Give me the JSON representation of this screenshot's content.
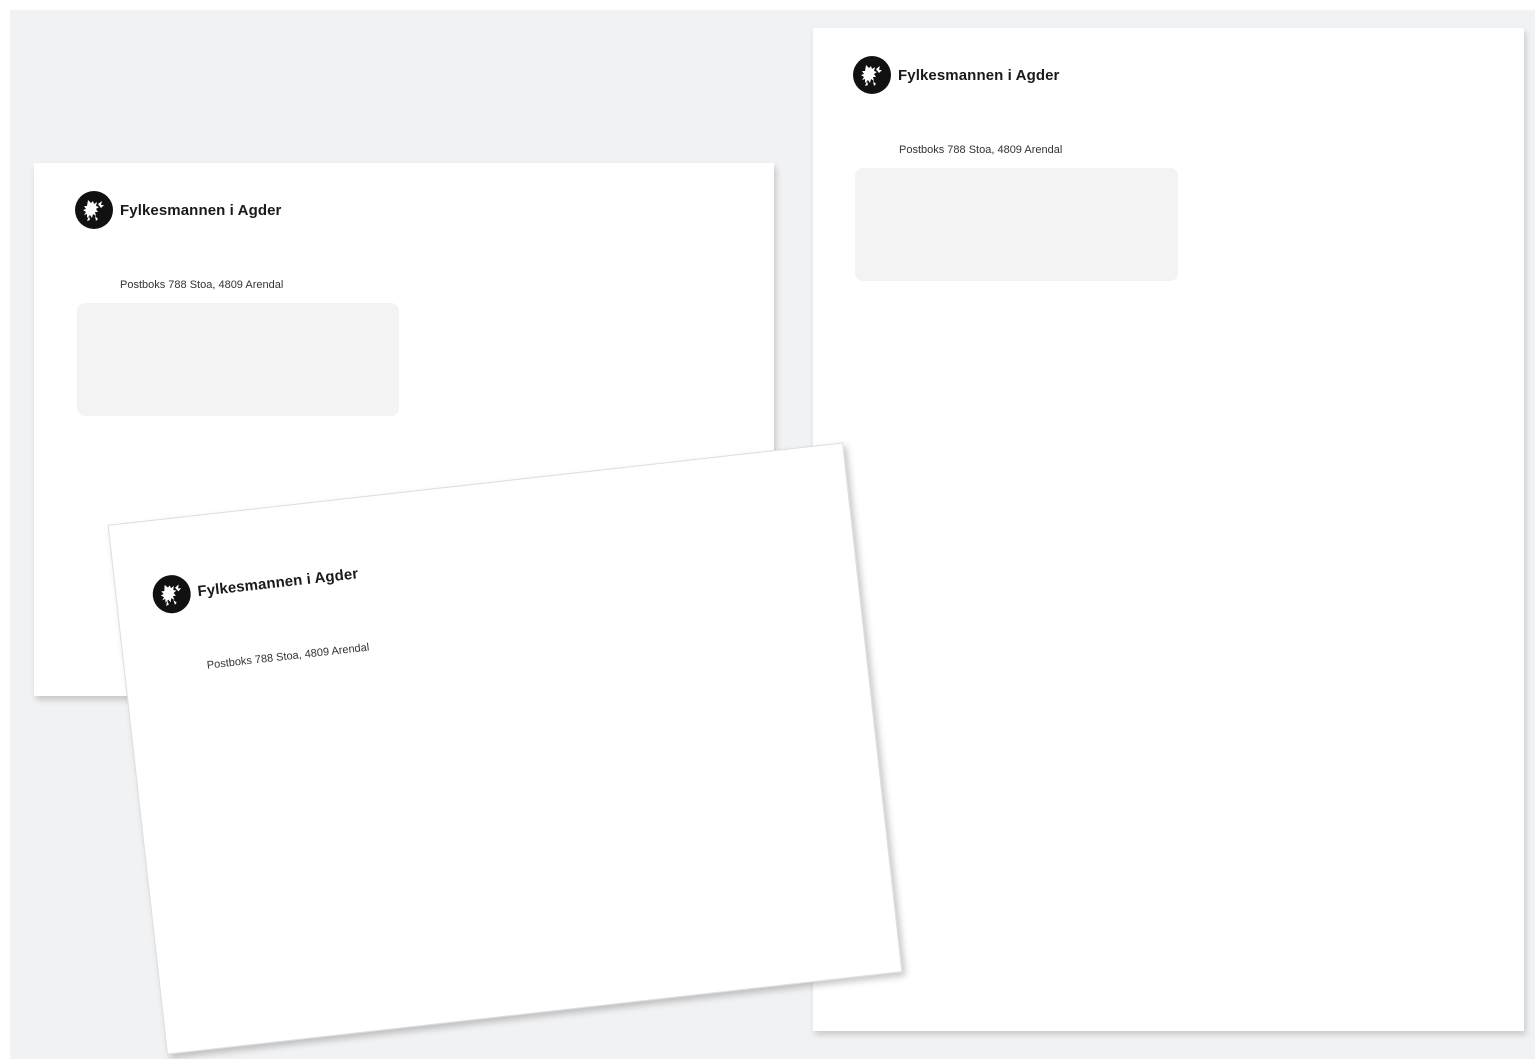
{
  "organization": {
    "name": "Fylkesmannen i Agder",
    "return_address": "Postboks 788 Stoa, 4809 Arendal",
    "emblem_icon": "norwegian-lion-emblem-icon"
  },
  "colors": {
    "background": "#f1f2f4",
    "paper": "#ffffff",
    "address_window": "#f3f3f3",
    "emblem": "#111111"
  }
}
